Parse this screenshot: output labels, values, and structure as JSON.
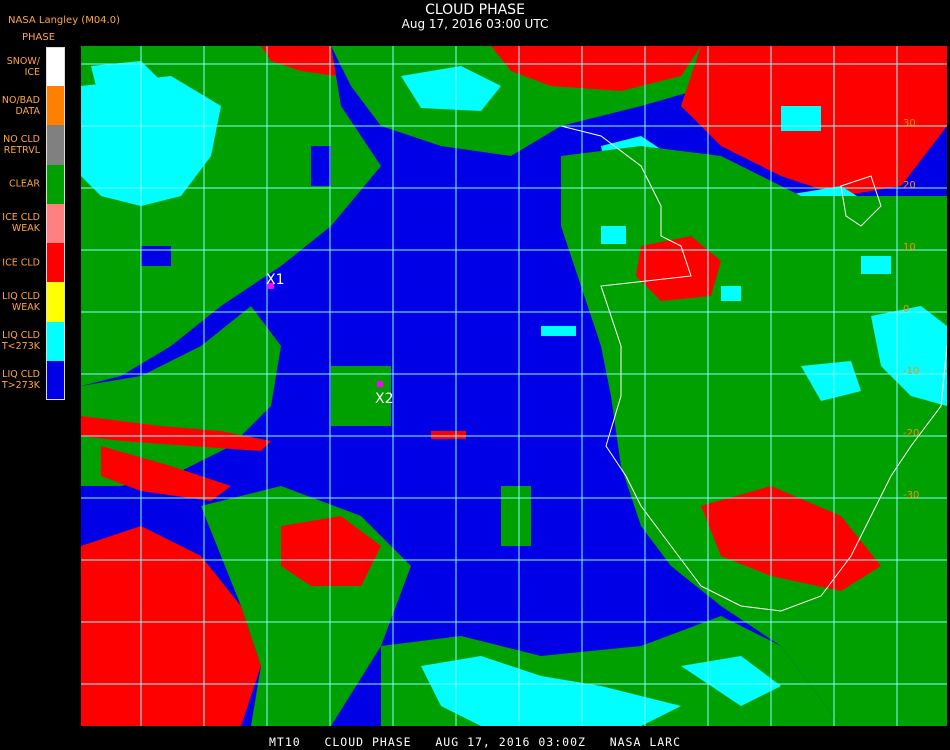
{
  "header": {
    "provider": "NASA Langley (M04.0)",
    "title": "CLOUD PHASE",
    "subtitle": "Aug 17, 2016 03:00 UTC"
  },
  "legend": {
    "title": "PHASE",
    "items": [
      {
        "label": "SNOW/\nICE",
        "color": "#ffffff"
      },
      {
        "label": "NO/BAD\nDATA",
        "color": "#ff7f00"
      },
      {
        "label": "NO CLD\nRETRVL",
        "color": "#808080"
      },
      {
        "label": "CLEAR",
        "color": "#00a000"
      },
      {
        "label": "ICE CLD\nWEAK",
        "color": "#ff8080"
      },
      {
        "label": "ICE CLD",
        "color": "#ff0000"
      },
      {
        "label": "LIQ CLD\nWEAK",
        "color": "#ffff00"
      },
      {
        "label": "LIQ CLD\nT<273K",
        "color": "#00ffff"
      },
      {
        "label": "LIQ CLD\nT>273K",
        "color": "#0000e6"
      }
    ]
  },
  "markers": [
    {
      "label": "X1",
      "color": "#ff00ff"
    },
    {
      "label": "X2",
      "color": "#ff00ff"
    }
  ],
  "grid_labels": [
    "30",
    "20",
    "10",
    "0",
    "-10",
    "-20",
    "-30"
  ],
  "colors": {
    "ocean_liquid": "#0000e6",
    "clear": "#00a000",
    "ice": "#ff0000",
    "liquid_cold": "#00ffff",
    "grid": "#7fffff",
    "coast": "#ffffff",
    "grid_label": "#ff8c00"
  },
  "footer": "MT10   CLOUD PHASE   AUG 17, 2016 03:00Z   NASA LARC"
}
